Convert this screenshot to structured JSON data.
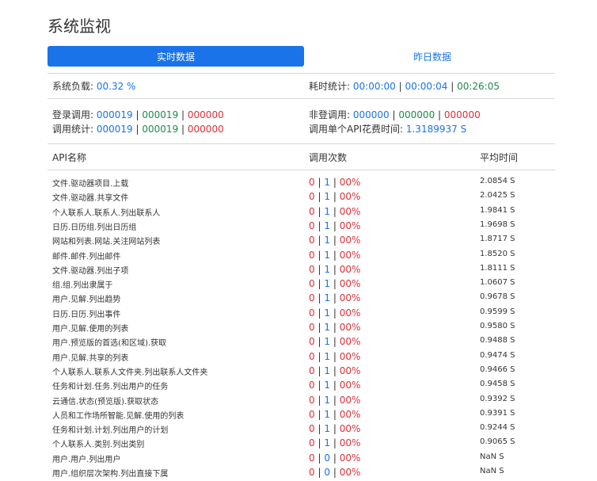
{
  "page": {
    "title": "系统监视"
  },
  "tabs": [
    {
      "label": "实时数据",
      "active": true
    },
    {
      "label": "昨日数据",
      "active": false
    }
  ],
  "stats": {
    "load_label": "系统负载:",
    "load_value": "00.32 %",
    "time_label": "耗时统计:",
    "time_values": [
      "00:00:00",
      "00:00:04",
      "00:26:05"
    ],
    "login_calls_label": "登录调用:",
    "login_calls": [
      "000019",
      "000019",
      "000000"
    ],
    "nonlogin_calls_label": "非登调用:",
    "nonlogin_calls": [
      "000000",
      "000000",
      "000000"
    ],
    "call_stats_label": "调用统计:",
    "call_stats": [
      "000019",
      "000019",
      "000000"
    ],
    "single_api_label": "调用单个API花费时间:",
    "single_api_value": "1.3189937 S"
  },
  "table": {
    "headers": {
      "name": "API名称",
      "calls": "调用次数",
      "avg": "平均时间"
    },
    "rows": [
      {
        "name": "文件.驱动器项目.上载",
        "c1": "0",
        "c2": "1",
        "pct": "00%",
        "avg": "2.0854 S"
      },
      {
        "name": "文件.驱动器.共享文件",
        "c1": "0",
        "c2": "1",
        "pct": "00%",
        "avg": "2.0425 S"
      },
      {
        "name": "个人联系人.联系人.列出联系人",
        "c1": "0",
        "c2": "1",
        "pct": "00%",
        "avg": "1.9841 S"
      },
      {
        "name": "日历.日历组.列出日历组",
        "c1": "0",
        "c2": "1",
        "pct": "00%",
        "avg": "1.9698 S"
      },
      {
        "name": "网站和列表.网站.关注网站列表",
        "c1": "0",
        "c2": "1",
        "pct": "00%",
        "avg": "1.8717 S"
      },
      {
        "name": "邮件.邮件.列出邮件",
        "c1": "0",
        "c2": "1",
        "pct": "00%",
        "avg": "1.8520 S"
      },
      {
        "name": "文件.驱动器.列出子项",
        "c1": "0",
        "c2": "1",
        "pct": "00%",
        "avg": "1.8111 S"
      },
      {
        "name": "组.组.列出隶属于",
        "c1": "0",
        "c2": "1",
        "pct": "00%",
        "avg": "1.0607 S"
      },
      {
        "name": "用户.见解.列出趋势",
        "c1": "0",
        "c2": "1",
        "pct": "00%",
        "avg": "0.9678 S"
      },
      {
        "name": "日历.日历.列出事件",
        "c1": "0",
        "c2": "1",
        "pct": "00%",
        "avg": "0.9599 S"
      },
      {
        "name": "用户.见解.使用的列表",
        "c1": "0",
        "c2": "1",
        "pct": "00%",
        "avg": "0.9580 S"
      },
      {
        "name": "用户.预览版的首选(和区域).获取",
        "c1": "0",
        "c2": "1",
        "pct": "00%",
        "avg": "0.9488 S"
      },
      {
        "name": "用户.见解.共享的列表",
        "c1": "0",
        "c2": "1",
        "pct": "00%",
        "avg": "0.9474 S"
      },
      {
        "name": "个人联系人.联系人文件夹.列出联系人文件夹",
        "c1": "0",
        "c2": "1",
        "pct": "00%",
        "avg": "0.9466 S"
      },
      {
        "name": "任务和计划.任务.列出用户的任务",
        "c1": "0",
        "c2": "1",
        "pct": "00%",
        "avg": "0.9458 S"
      },
      {
        "name": "云通信.状态(预览版).获取状态",
        "c1": "0",
        "c2": "1",
        "pct": "00%",
        "avg": "0.9392 S"
      },
      {
        "name": "人员和工作场所智能.见解.使用的列表",
        "c1": "0",
        "c2": "1",
        "pct": "00%",
        "avg": "0.9391 S"
      },
      {
        "name": "任务和计划.计划.列出用户的计划",
        "c1": "0",
        "c2": "1",
        "pct": "00%",
        "avg": "0.9244 S"
      },
      {
        "name": "个人联系人.类别.列出类别",
        "c1": "0",
        "c2": "1",
        "pct": "00%",
        "avg": "0.9065 S"
      },
      {
        "name": "用户.用户.列出用户",
        "c1": "0",
        "c2": "0",
        "pct": "00%",
        "avg": "NaN S"
      },
      {
        "name": "用户.组织层次架构.列出直接下属",
        "c1": "0",
        "c2": "0",
        "pct": "00%",
        "avg": "NaN S"
      }
    ]
  }
}
